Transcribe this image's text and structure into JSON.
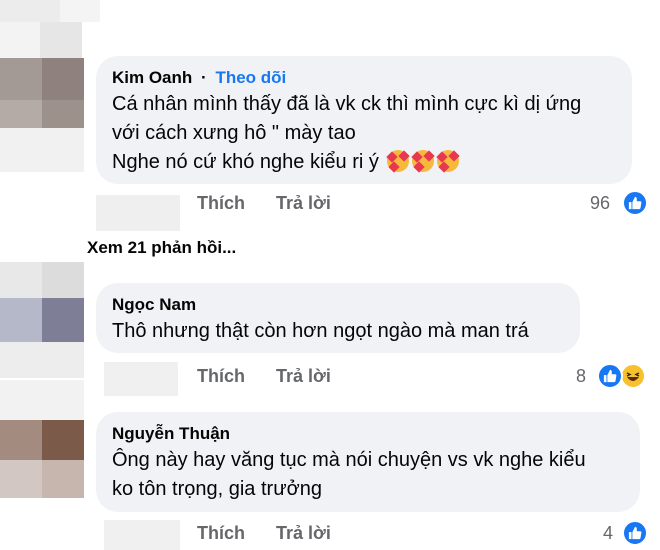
{
  "comments": [
    {
      "author": "Kim Oanh",
      "separator": "·",
      "follow_label": "Theo dõi",
      "lines": [
        "Cá nhân mình thấy đã là vk ck thì mình cực kì dị ứng",
        "với cách xưng hô \" mày tao",
        "Nghe nó cứ khó nghe kiểu ri ý"
      ],
      "emojis": [
        "smiling-face-with-hearts",
        "smiling-face-with-hearts",
        "smiling-face-with-hearts"
      ],
      "like_label": "Thích",
      "reply_label": "Trả lời",
      "reaction_count": "96",
      "reactions": [
        "like"
      ]
    },
    {
      "author": "Ngọc Nam",
      "lines": [
        "Thô nhưng thật còn hơn ngọt ngào mà man trá"
      ],
      "like_label": "Thích",
      "reply_label": "Trả lời",
      "reaction_count": "8",
      "reactions": [
        "like",
        "haha"
      ]
    },
    {
      "author": "Nguyễn Thuận",
      "lines": [
        "Ông này hay văng tục mà nói chuyện vs vk nghe kiểu",
        "ko tôn trọng, gia trưởng"
      ],
      "like_label": "Thích",
      "reply_label": "Trả lời",
      "reaction_count": "4",
      "reactions": [
        "like"
      ]
    }
  ],
  "view_replies_label": "Xem 21 phản hồi...",
  "colors": {
    "bubble": "#f0f2f5",
    "accent": "#1877f2",
    "secondary_text": "#65676b",
    "haha": "#f7c12e"
  }
}
